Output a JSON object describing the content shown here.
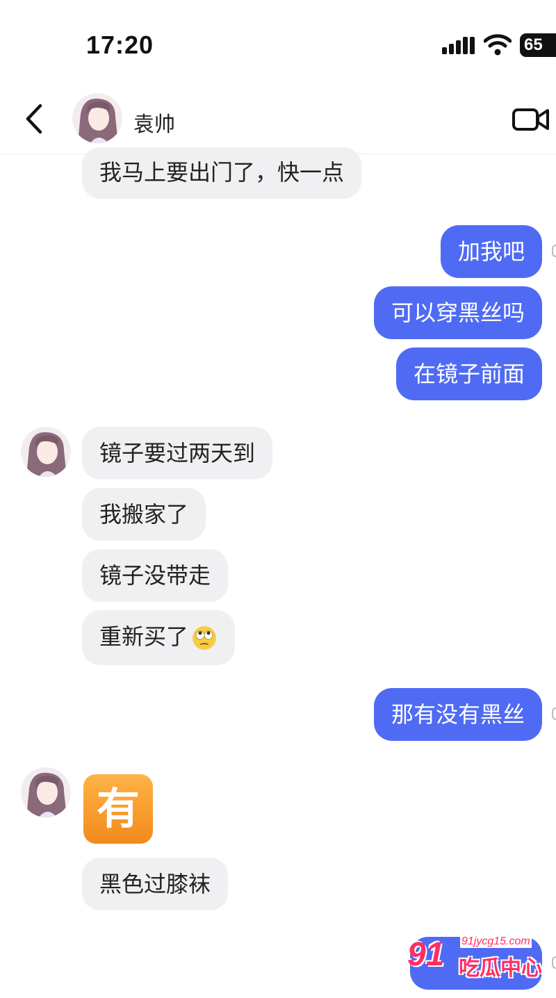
{
  "status_bar": {
    "time": "17:20",
    "battery": "65"
  },
  "header": {
    "contact_name": "袁帅"
  },
  "messages": [
    {
      "from": "them",
      "text": "我马上要出门了，快一点"
    },
    {
      "from": "me",
      "text": "加我吧"
    },
    {
      "from": "me",
      "text": "可以穿黑丝吗"
    },
    {
      "from": "me",
      "text": "在镜子前面"
    },
    {
      "from": "them",
      "text": "镜子要过两天到"
    },
    {
      "from": "them",
      "text": "我搬家了"
    },
    {
      "from": "them",
      "text": "镜子没带走"
    },
    {
      "from": "them",
      "text": "重新买了"
    },
    {
      "from": "me",
      "text": "那有没有黑丝"
    },
    {
      "from": "them",
      "text": "有"
    },
    {
      "from": "them",
      "text": "黑色过膝袜"
    }
  ],
  "watermark": {
    "number": "91",
    "url": "91jycg15.com",
    "name": "吃瓜中心"
  },
  "colors": {
    "outgoing_bubble": "#4f6bf4",
    "incoming_bubble": "#f0f0f2",
    "watermark": "#ff2e63"
  },
  "icons": {
    "back": "chevron-left-icon",
    "video": "video-camera-icon",
    "signal": "signal-icon",
    "wifi": "wifi-icon"
  }
}
